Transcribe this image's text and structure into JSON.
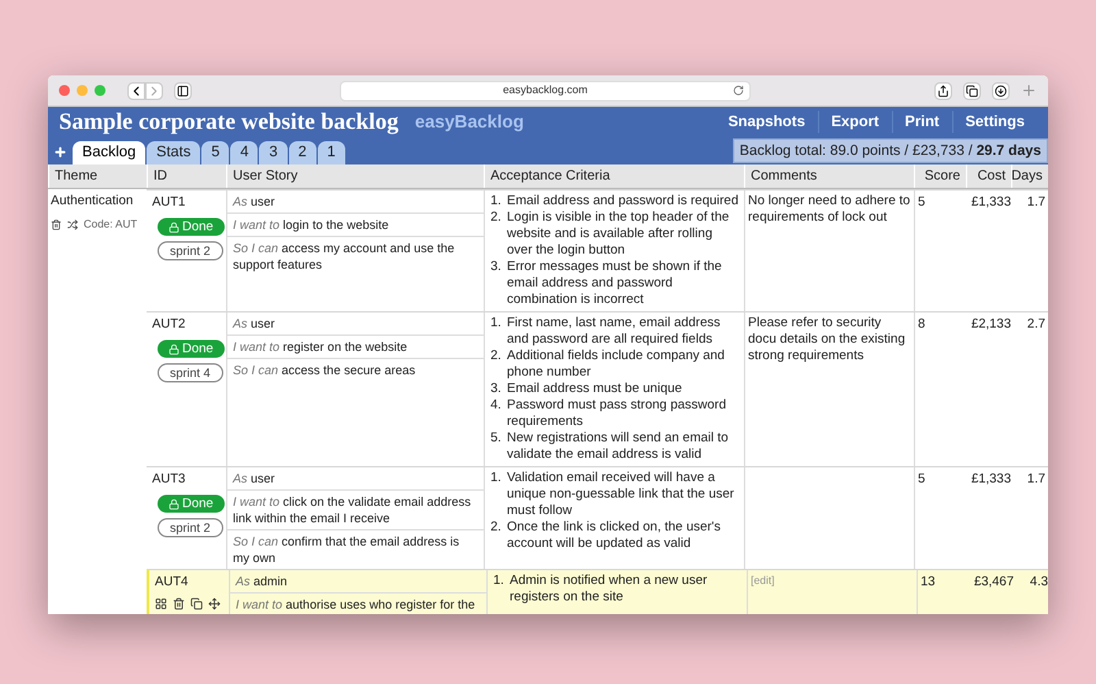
{
  "browser": {
    "url": "easybacklog.com"
  },
  "header": {
    "title": "Sample corporate website backlog",
    "brand": "easyBacklog",
    "menu": [
      "Snapshots",
      "Export",
      "Print",
      "Settings"
    ]
  },
  "tabs": [
    {
      "label": "Backlog",
      "selected": true
    },
    {
      "label": "Stats",
      "selected": false
    },
    {
      "label": "5",
      "selected": false
    },
    {
      "label": "4",
      "selected": false
    },
    {
      "label": "3",
      "selected": false
    },
    {
      "label": "2",
      "selected": false
    },
    {
      "label": "1",
      "selected": false
    }
  ],
  "total": "Backlog total: 89.0 points / £23,733 / **29.7 days**",
  "table": {
    "columns": [
      "Theme",
      "ID",
      "User Story",
      "Acceptance Criteria",
      "Comments",
      "Score",
      "Cost",
      "Days"
    ],
    "theme": {
      "name": "Authentication",
      "code": "Code: AUT"
    },
    "rows": [
      {
        "id": "AUT1",
        "selected": false,
        "status": "Done",
        "sprint": "sprint 2",
        "story": [
          {
            "lead": "As",
            "text": "user"
          },
          {
            "lead": "I want to",
            "text": "login to the website"
          },
          {
            "lead": "So I can",
            "text": "access my account and use the support features"
          }
        ],
        "criteria": [
          {
            "n": "1.",
            "text": "Email address and password is required"
          },
          {
            "n": "2.",
            "text": "Login is visible in the top header of the website and is available after rolling over the login button"
          },
          {
            "n": "3.",
            "text": "Error messages must be shown if the email address and password combination is incorrect"
          }
        ],
        "comment": {
          "kind": "text",
          "text": "No longer need to adhere to requirements of lock out"
        },
        "score": "5",
        "cost": "£1,333",
        "days": "1.7"
      },
      {
        "id": "AUT2",
        "selected": false,
        "status": "Done",
        "sprint": "sprint 4",
        "story": [
          {
            "lead": "As",
            "text": "user"
          },
          {
            "lead": "I want to",
            "text": "register on the website"
          },
          {
            "lead": "So I can",
            "text": "access the secure areas"
          }
        ],
        "criteria": [
          {
            "n": "1.",
            "text": "First name, last name, email address and password are all required fields"
          },
          {
            "n": "2.",
            "text": "Additional fields include company and phone number"
          },
          {
            "n": "3.",
            "text": "Email address must be unique"
          },
          {
            "n": "4.",
            "text": "Password must pass strong password requirements"
          },
          {
            "n": "5.",
            "text": "New registrations will send an email to validate the email address is valid"
          }
        ],
        "comment": {
          "kind": "text",
          "text": "Please refer to security docu details on the existing strong requirements"
        },
        "score": "8",
        "cost": "£2,133",
        "days": "2.7"
      },
      {
        "id": "AUT3",
        "selected": false,
        "status": "Done",
        "sprint": "sprint 2",
        "story": [
          {
            "lead": "As",
            "text": "user"
          },
          {
            "lead": "I want to",
            "text": "click on the validate email address link within the email I receive"
          },
          {
            "lead": "So I can",
            "text": "confirm that the email address is my own"
          }
        ],
        "criteria": [
          {
            "n": "1.",
            "text": "Validation email received will have a unique non-guessable link that the user must follow"
          },
          {
            "n": "2.",
            "text": "Once the link is clicked on, the user's account will be updated as valid"
          }
        ],
        "score": "5",
        "cost": "£1,333",
        "days": "1.7"
      },
      {
        "id": "AUT4",
        "selected": true,
        "story": [
          {
            "lead": "As",
            "text": "admin"
          },
          {
            "lead": "I want to",
            "text": "authorise uses who register for the"
          }
        ],
        "criteria": [
          {
            "n": "1.",
            "text": "Admin is notified when a new user registers on the site"
          }
        ],
        "comment": {
          "kind": "edit",
          "text": "[edit]"
        },
        "score": "13",
        "cost": "£3,467",
        "days": "4.3"
      }
    ]
  }
}
